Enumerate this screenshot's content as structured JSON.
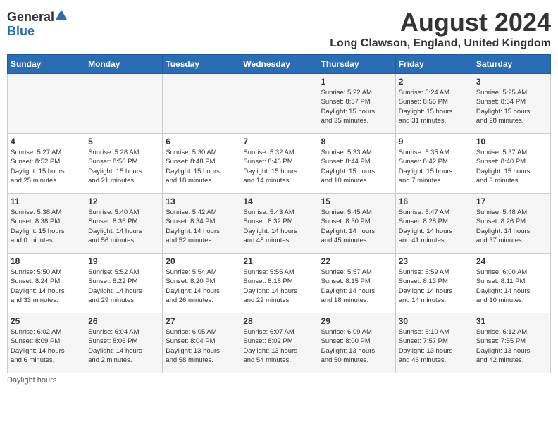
{
  "logo": {
    "general": "General",
    "blue": "Blue"
  },
  "title": "August 2024",
  "subtitle": "Long Clawson, England, United Kingdom",
  "headers": [
    "Sunday",
    "Monday",
    "Tuesday",
    "Wednesday",
    "Thursday",
    "Friday",
    "Saturday"
  ],
  "weeks": [
    [
      {
        "day": "",
        "info": ""
      },
      {
        "day": "",
        "info": ""
      },
      {
        "day": "",
        "info": ""
      },
      {
        "day": "",
        "info": ""
      },
      {
        "day": "1",
        "info": "Sunrise: 5:22 AM\nSunset: 8:57 PM\nDaylight: 15 hours\nand 35 minutes."
      },
      {
        "day": "2",
        "info": "Sunrise: 5:24 AM\nSunset: 8:55 PM\nDaylight: 15 hours\nand 31 minutes."
      },
      {
        "day": "3",
        "info": "Sunrise: 5:25 AM\nSunset: 8:54 PM\nDaylight: 15 hours\nand 28 minutes."
      }
    ],
    [
      {
        "day": "4",
        "info": "Sunrise: 5:27 AM\nSunset: 8:52 PM\nDaylight: 15 hours\nand 25 minutes."
      },
      {
        "day": "5",
        "info": "Sunrise: 5:28 AM\nSunset: 8:50 PM\nDaylight: 15 hours\nand 21 minutes."
      },
      {
        "day": "6",
        "info": "Sunrise: 5:30 AM\nSunset: 8:48 PM\nDaylight: 15 hours\nand 18 minutes."
      },
      {
        "day": "7",
        "info": "Sunrise: 5:32 AM\nSunset: 8:46 PM\nDaylight: 15 hours\nand 14 minutes."
      },
      {
        "day": "8",
        "info": "Sunrise: 5:33 AM\nSunset: 8:44 PM\nDaylight: 15 hours\nand 10 minutes."
      },
      {
        "day": "9",
        "info": "Sunrise: 5:35 AM\nSunset: 8:42 PM\nDaylight: 15 hours\nand 7 minutes."
      },
      {
        "day": "10",
        "info": "Sunrise: 5:37 AM\nSunset: 8:40 PM\nDaylight: 15 hours\nand 3 minutes."
      }
    ],
    [
      {
        "day": "11",
        "info": "Sunrise: 5:38 AM\nSunset: 8:38 PM\nDaylight: 15 hours\nand 0 minutes."
      },
      {
        "day": "12",
        "info": "Sunrise: 5:40 AM\nSunset: 8:36 PM\nDaylight: 14 hours\nand 56 minutes."
      },
      {
        "day": "13",
        "info": "Sunrise: 5:42 AM\nSunset: 8:34 PM\nDaylight: 14 hours\nand 52 minutes."
      },
      {
        "day": "14",
        "info": "Sunrise: 5:43 AM\nSunset: 8:32 PM\nDaylight: 14 hours\nand 48 minutes."
      },
      {
        "day": "15",
        "info": "Sunrise: 5:45 AM\nSunset: 8:30 PM\nDaylight: 14 hours\nand 45 minutes."
      },
      {
        "day": "16",
        "info": "Sunrise: 5:47 AM\nSunset: 8:28 PM\nDaylight: 14 hours\nand 41 minutes."
      },
      {
        "day": "17",
        "info": "Sunrise: 5:48 AM\nSunset: 8:26 PM\nDaylight: 14 hours\nand 37 minutes."
      }
    ],
    [
      {
        "day": "18",
        "info": "Sunrise: 5:50 AM\nSunset: 8:24 PM\nDaylight: 14 hours\nand 33 minutes."
      },
      {
        "day": "19",
        "info": "Sunrise: 5:52 AM\nSunset: 8:22 PM\nDaylight: 14 hours\nand 29 minutes."
      },
      {
        "day": "20",
        "info": "Sunrise: 5:54 AM\nSunset: 8:20 PM\nDaylight: 14 hours\nand 26 minutes."
      },
      {
        "day": "21",
        "info": "Sunrise: 5:55 AM\nSunset: 8:18 PM\nDaylight: 14 hours\nand 22 minutes."
      },
      {
        "day": "22",
        "info": "Sunrise: 5:57 AM\nSunset: 8:15 PM\nDaylight: 14 hours\nand 18 minutes."
      },
      {
        "day": "23",
        "info": "Sunrise: 5:59 AM\nSunset: 8:13 PM\nDaylight: 14 hours\nand 14 minutes."
      },
      {
        "day": "24",
        "info": "Sunrise: 6:00 AM\nSunset: 8:11 PM\nDaylight: 14 hours\nand 10 minutes."
      }
    ],
    [
      {
        "day": "25",
        "info": "Sunrise: 6:02 AM\nSunset: 8:09 PM\nDaylight: 14 hours\nand 6 minutes."
      },
      {
        "day": "26",
        "info": "Sunrise: 6:04 AM\nSunset: 8:06 PM\nDaylight: 14 hours\nand 2 minutes."
      },
      {
        "day": "27",
        "info": "Sunrise: 6:05 AM\nSunset: 8:04 PM\nDaylight: 13 hours\nand 58 minutes."
      },
      {
        "day": "28",
        "info": "Sunrise: 6:07 AM\nSunset: 8:02 PM\nDaylight: 13 hours\nand 54 minutes."
      },
      {
        "day": "29",
        "info": "Sunrise: 6:09 AM\nSunset: 8:00 PM\nDaylight: 13 hours\nand 50 minutes."
      },
      {
        "day": "30",
        "info": "Sunrise: 6:10 AM\nSunset: 7:57 PM\nDaylight: 13 hours\nand 46 minutes."
      },
      {
        "day": "31",
        "info": "Sunrise: 6:12 AM\nSunset: 7:55 PM\nDaylight: 13 hours\nand 42 minutes."
      }
    ]
  ],
  "footer": "Daylight hours"
}
